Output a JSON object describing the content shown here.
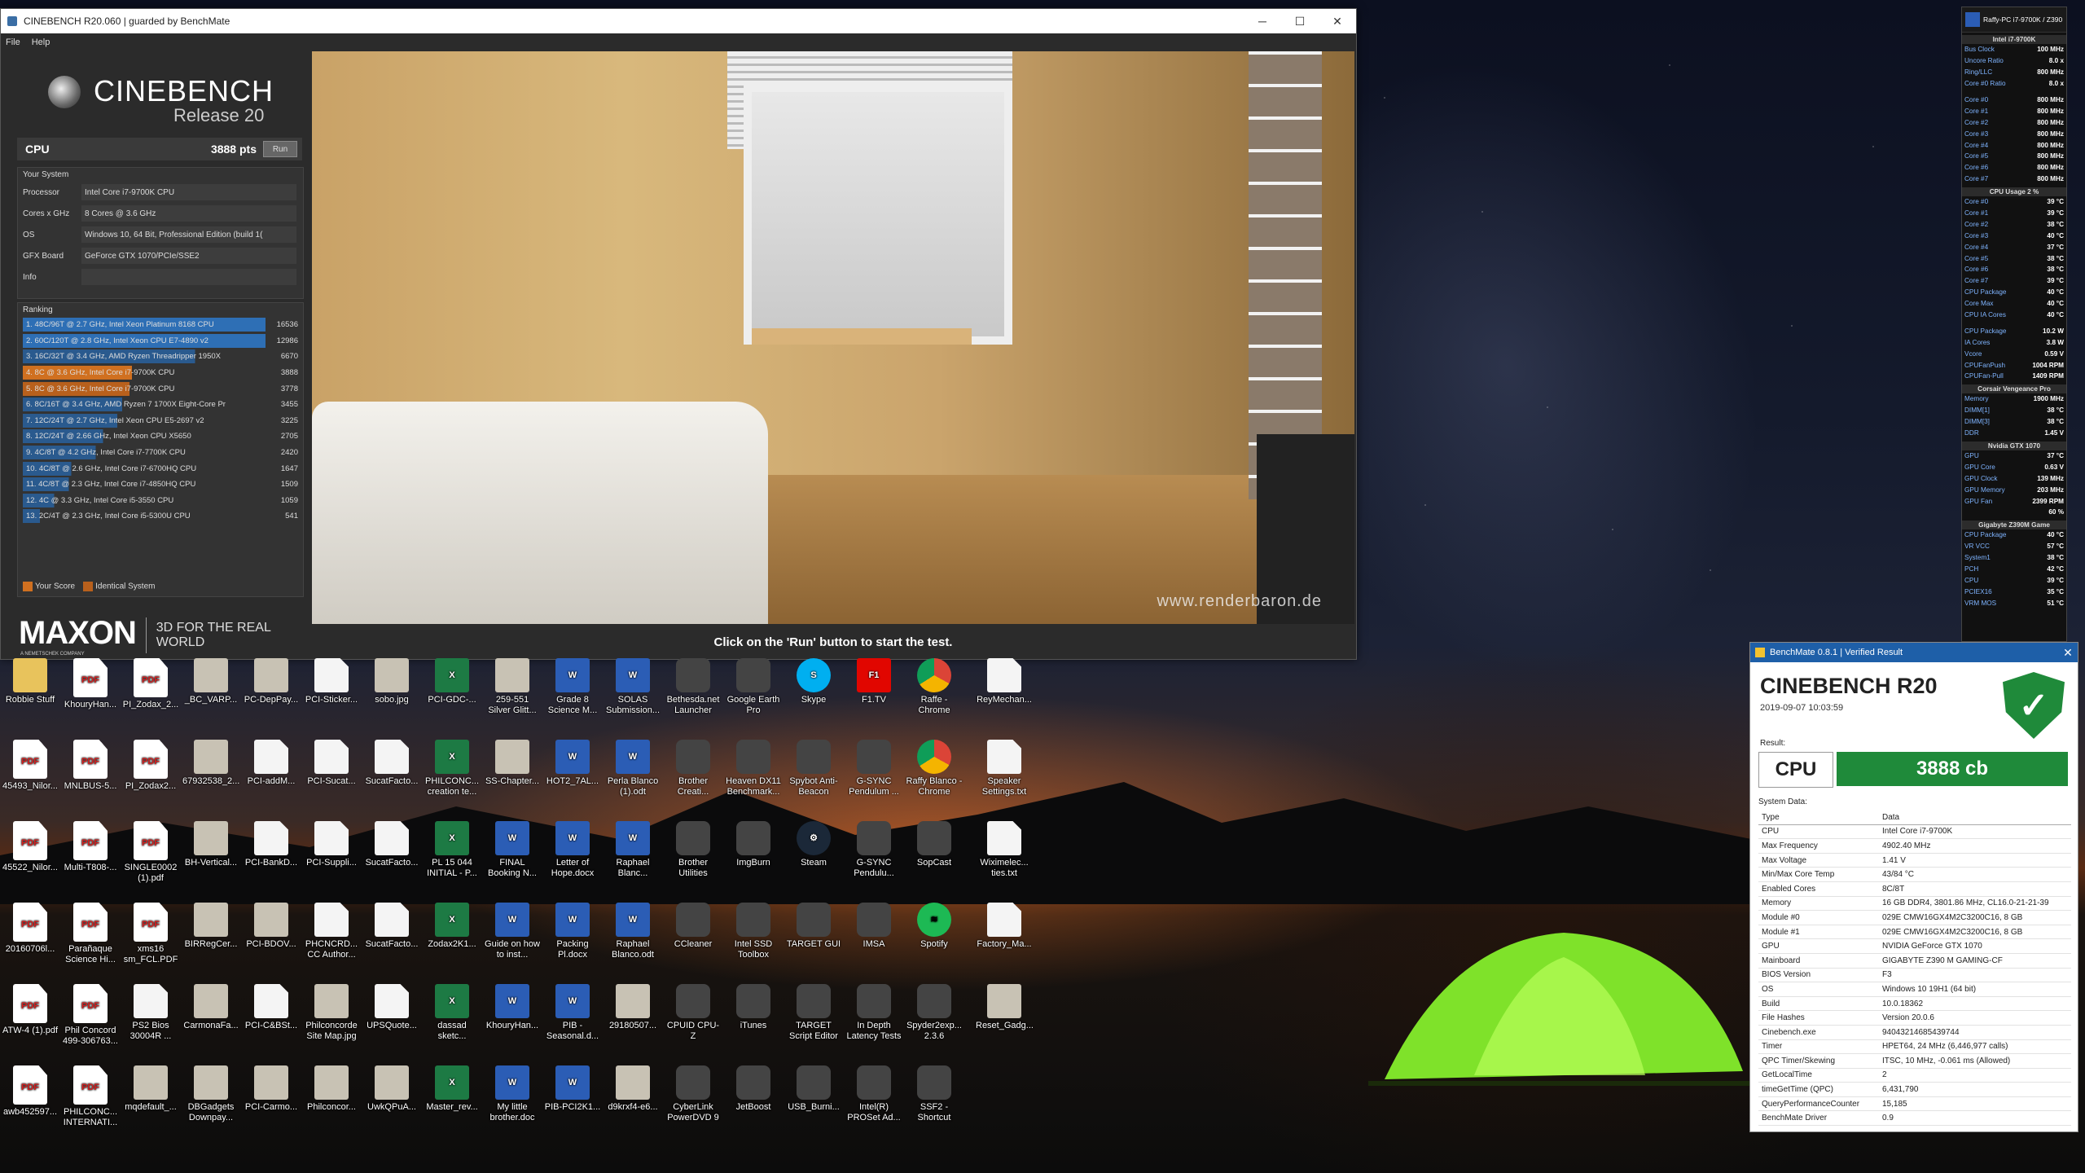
{
  "cinebench": {
    "window_title": "CINEBENCH R20.060 | guarded by BenchMate",
    "menu": [
      "File",
      "Help"
    ],
    "logo_title": "CINEBENCH",
    "logo_sub": "Release 20",
    "cpu_label": "CPU",
    "cpu_score": "3888 pts",
    "run_label": "Run",
    "your_system_title": "Your System",
    "system": [
      {
        "k": "Processor",
        "v": "Intel Core i7-9700K CPU"
      },
      {
        "k": "Cores x GHz",
        "v": "8 Cores @ 3.6 GHz"
      },
      {
        "k": "OS",
        "v": "Windows 10, 64 Bit, Professional Edition (build 1("
      },
      {
        "k": "GFX Board",
        "v": "GeForce GTX 1070/PCIe/SSE2"
      },
      {
        "k": "Info",
        "v": ""
      }
    ],
    "ranking_title": "Ranking",
    "ranking": [
      {
        "t": "1. 48C/96T @ 2.7 GHz, Intel Xeon Platinum 8168 CPU",
        "s": "16536",
        "c": "#2e6fb5"
      },
      {
        "t": "2. 60C/120T @ 2.8 GHz, Intel Xeon CPU E7-4890 v2",
        "s": "12986",
        "c": "#2e6fb5"
      },
      {
        "t": "3. 16C/32T @ 3.4 GHz, AMD Ryzen Threadripper 1950X",
        "s": "6670",
        "c": "#2a5a8e"
      },
      {
        "t": "4. 8C @ 3.6 GHz, Intel Core i7-9700K CPU",
        "s": "3888",
        "c": "#d07020"
      },
      {
        "t": "5. 8C @ 3.6 GHz, Intel Core i7-9700K CPU",
        "s": "3778",
        "c": "#b8601c"
      },
      {
        "t": "6. 8C/16T @ 3.4 GHz, AMD Ryzen 7 1700X Eight-Core Pr",
        "s": "3455",
        "c": "#2a5a8e"
      },
      {
        "t": "7. 12C/24T @ 2.7 GHz, Intel Xeon CPU E5-2697 v2",
        "s": "3225",
        "c": "#2a5a8e"
      },
      {
        "t": "8. 12C/24T @ 2.66 GHz, Intel Xeon CPU X5650",
        "s": "2705",
        "c": "#2a5a8e"
      },
      {
        "t": "9. 4C/8T @ 4.2 GHz, Intel Core i7-7700K CPU",
        "s": "2420",
        "c": "#2a5a8e"
      },
      {
        "t": "10. 4C/8T @ 2.6 GHz, Intel Core i7-6700HQ CPU",
        "s": "1647",
        "c": "#2a5a8e"
      },
      {
        "t": "11. 4C/8T @ 2.3 GHz, Intel Core i7-4850HQ CPU",
        "s": "1509",
        "c": "#2a5a8e"
      },
      {
        "t": "12. 4C @ 3.3 GHz, Intel Core i5-3550 CPU",
        "s": "1059",
        "c": "#2a5a8e"
      },
      {
        "t": "13. 2C/4T @ 2.3 GHz, Intel Core i5-5300U CPU",
        "s": "541",
        "c": "#2a5a8e"
      }
    ],
    "ranking_fill": [
      1.0,
      1.0,
      0.71,
      0.45,
      0.44,
      0.41,
      0.39,
      0.33,
      0.3,
      0.2,
      0.19,
      0.13,
      0.07
    ],
    "legend_your": "Your Score",
    "legend_identical": "Identical System",
    "maxon": "MAXON",
    "maxon_small": "A NEMETSCHEK COMPANY",
    "maxon_tag": "3D FOR THE REAL WORLD",
    "render_credit": "www.renderbaron.de",
    "status_text": "Click on the 'Run' button to start the test."
  },
  "desktop_icons": [
    [
      {
        "l": "Robbie Stuff",
        "i": "folder"
      },
      {
        "l": "KhouryHan...",
        "i": "pdf"
      },
      {
        "l": "PI_Zodax_2...",
        "i": "pdf"
      },
      {
        "l": "_BC_VARP...",
        "i": "img"
      },
      {
        "l": "PC-DepPay...",
        "i": "img"
      },
      {
        "l": "PCI-Sticker...",
        "i": "txt"
      },
      {
        "l": "sobo.jpg",
        "i": "img"
      },
      {
        "l": "PCI-GDC-...",
        "i": "xls"
      },
      {
        "l": "259-551 Silver Glitt...",
        "i": "img"
      },
      {
        "l": "Grade 8 Science M...",
        "i": "doc"
      },
      {
        "l": "SOLAS Submission...",
        "i": "doc"
      },
      {
        "l": "Bethesda.net Launcher",
        "i": "app"
      },
      {
        "l": "Google Earth Pro",
        "i": "app"
      },
      {
        "l": "Skype",
        "i": "skype"
      },
      {
        "l": "F1.TV",
        "i": "f1"
      },
      {
        "l": "Raffe - Chrome",
        "i": "chrome"
      },
      {
        "l": "ReyMechan...",
        "i": "txt"
      }
    ],
    [
      {
        "l": "45493_Nilor...",
        "i": "pdf"
      },
      {
        "l": "MNLBUS-5...",
        "i": "pdf"
      },
      {
        "l": "PI_Zodax2...",
        "i": "pdf"
      },
      {
        "l": "67932538_2...",
        "i": "img"
      },
      {
        "l": "PCI-addM...",
        "i": "txt"
      },
      {
        "l": "PCI-Sucat...",
        "i": "txt"
      },
      {
        "l": "SucatFacto...",
        "i": "txt"
      },
      {
        "l": "PHILCONC... creation te...",
        "i": "xls"
      },
      {
        "l": "SS-Chapter...",
        "i": "img"
      },
      {
        "l": "HOT2_7AL...",
        "i": "doc"
      },
      {
        "l": "Perla Blanco (1).odt",
        "i": "doc"
      },
      {
        "l": "Brother Creati...",
        "i": "app"
      },
      {
        "l": "Heaven DX11 Benchmark...",
        "i": "app"
      },
      {
        "l": "Spybot Anti-Beacon",
        "i": "app"
      },
      {
        "l": "G-SYNC Pendulum ...",
        "i": "app"
      },
      {
        "l": "Raffy Blanco - Chrome",
        "i": "chrome"
      },
      {
        "l": "Speaker Settings.txt",
        "i": "txt"
      }
    ],
    [
      {
        "l": "45522_Nilor...",
        "i": "pdf"
      },
      {
        "l": "Multi-T808-...",
        "i": "pdf"
      },
      {
        "l": "SINGLE0002 (1).pdf",
        "i": "pdf"
      },
      {
        "l": "BH-Vertical...",
        "i": "img"
      },
      {
        "l": "PCI-BankD...",
        "i": "txt"
      },
      {
        "l": "PCI-Suppli...",
        "i": "txt"
      },
      {
        "l": "SucatFacto...",
        "i": "txt"
      },
      {
        "l": "PL 15 044 INITIAL - P...",
        "i": "xls"
      },
      {
        "l": "FINAL Booking N...",
        "i": "doc"
      },
      {
        "l": "Letter of Hope.docx",
        "i": "doc"
      },
      {
        "l": "Raphael Blanc...",
        "i": "doc"
      },
      {
        "l": "Brother Utilities",
        "i": "app"
      },
      {
        "l": "ImgBurn",
        "i": "app"
      },
      {
        "l": "Steam",
        "i": "steam"
      },
      {
        "l": "G-SYNC Pendulu...",
        "i": "app"
      },
      {
        "l": "SopCast",
        "i": "app"
      },
      {
        "l": "Wiximelec... ties.txt",
        "i": "txt"
      }
    ],
    [
      {
        "l": "20160706l...",
        "i": "pdf"
      },
      {
        "l": "Parañaque Science Hi...",
        "i": "pdf"
      },
      {
        "l": "xms16 sm_FCL.PDF",
        "i": "pdf"
      },
      {
        "l": "BIRRegCer...",
        "i": "img"
      },
      {
        "l": "PCI-BDOV...",
        "i": "img"
      },
      {
        "l": "PHCNCRD... CC Author...",
        "i": "txt"
      },
      {
        "l": "SucatFacto...",
        "i": "txt"
      },
      {
        "l": "Zodax2K1...",
        "i": "xls"
      },
      {
        "l": "Guide on how to inst...",
        "i": "doc"
      },
      {
        "l": "Packing Pl.docx",
        "i": "doc"
      },
      {
        "l": "Raphael Blanco.odt",
        "i": "doc"
      },
      {
        "l": "CCleaner",
        "i": "app"
      },
      {
        "l": "Intel SSD Toolbox",
        "i": "app"
      },
      {
        "l": "TARGET GUI",
        "i": "app"
      },
      {
        "l": "IMSA",
        "i": "app"
      },
      {
        "l": "Spotify",
        "i": "spotify"
      },
      {
        "l": "Factory_Ma...",
        "i": "txt"
      }
    ],
    [
      {
        "l": "ATW-4 (1).pdf",
        "i": "pdf"
      },
      {
        "l": "Phil Concord 499-306763...",
        "i": "pdf"
      },
      {
        "l": "PS2 Bios 30004R ...",
        "i": "txt"
      },
      {
        "l": "CarmonaFa...",
        "i": "img"
      },
      {
        "l": "PCI-C&BSt...",
        "i": "txt"
      },
      {
        "l": "Philconcorde Site Map.jpg",
        "i": "img"
      },
      {
        "l": "UPSQuote...",
        "i": "txt"
      },
      {
        "l": "dassad sketc...",
        "i": "xls"
      },
      {
        "l": "KhouryHan...",
        "i": "doc"
      },
      {
        "l": "PIB - Seasonal.d...",
        "i": "doc"
      },
      {
        "l": "29180507...",
        "i": "img"
      },
      {
        "l": "CPUID CPU-Z",
        "i": "app"
      },
      {
        "l": "iTunes",
        "i": "app"
      },
      {
        "l": "TARGET Script Editor",
        "i": "app"
      },
      {
        "l": "In Depth Latency Tests",
        "i": "app"
      },
      {
        "l": "Spyder2exp... 2.3.6",
        "i": "app"
      },
      {
        "l": "Reset_Gadg...",
        "i": "img"
      }
    ],
    [
      {
        "l": "awb452597...",
        "i": "pdf"
      },
      {
        "l": "PHILCONC... INTERNATI...",
        "i": "pdf"
      },
      {
        "l": "mqdefault_...",
        "i": "img"
      },
      {
        "l": "DBGadgets Downpay...",
        "i": "img"
      },
      {
        "l": "PCI-Carmo...",
        "i": "img"
      },
      {
        "l": "Philconcor...",
        "i": "img"
      },
      {
        "l": "UwkQPuA...",
        "i": "img"
      },
      {
        "l": "Master_rev...",
        "i": "xls"
      },
      {
        "l": "My little brother.doc",
        "i": "doc"
      },
      {
        "l": "PIB-PCI2K1...",
        "i": "doc"
      },
      {
        "l": "d9krxf4-e6...",
        "i": "img"
      },
      {
        "l": "CyberLink PowerDVD 9",
        "i": "app"
      },
      {
        "l": "JetBoost",
        "i": "app"
      },
      {
        "l": "USB_Burni...",
        "i": "app"
      },
      {
        "l": "Intel(R) PROSet Ad...",
        "i": "app"
      },
      {
        "l": "SSF2 - Shortcut",
        "i": "app"
      }
    ]
  ],
  "icon_glyphs": {
    "pdf": "PDF",
    "xls": "X",
    "doc": "W",
    "txt": "",
    "img": "",
    "app": "",
    "chrome": "",
    "skype": "S",
    "steam": "⚙",
    "spotify": "≋",
    "f1": "F1",
    "folder": ""
  },
  "hwinfo": {
    "header": "Raffy-PC i7-9700K / Z390",
    "sections": [
      {
        "title": "Intel i7-9700K",
        "rows": [
          [
            "Bus Clock",
            "100 MHz"
          ],
          [
            "Uncore Ratio",
            "8.0 x"
          ],
          [
            "Ring/LLC",
            "800 MHz"
          ],
          [
            "Core #0 Ratio",
            "8.0 x"
          ]
        ]
      },
      {
        "title": "",
        "rows": [
          [
            "Core #0",
            "800 MHz"
          ],
          [
            "Core #1",
            "800 MHz"
          ],
          [
            "Core #2",
            "800 MHz"
          ],
          [
            "Core #3",
            "800 MHz"
          ],
          [
            "Core #4",
            "800 MHz"
          ],
          [
            "Core #5",
            "800 MHz"
          ],
          [
            "Core #6",
            "800 MHz"
          ],
          [
            "Core #7",
            "800 MHz"
          ]
        ]
      },
      {
        "title": "CPU Usage  2 %",
        "rows": [
          [
            "Core #0",
            "39 °C"
          ],
          [
            "Core #1",
            "39 °C"
          ],
          [
            "Core #2",
            "38 °C"
          ],
          [
            "Core #3",
            "40 °C"
          ],
          [
            "Core #4",
            "37 °C"
          ],
          [
            "Core #5",
            "38 °C"
          ],
          [
            "Core #6",
            "38 °C"
          ],
          [
            "Core #7",
            "39 °C"
          ],
          [
            "CPU Package",
            "40 °C"
          ],
          [
            "Core Max",
            "40 °C"
          ],
          [
            "CPU IA Cores",
            "40 °C"
          ]
        ]
      },
      {
        "title": "",
        "rows": [
          [
            "CPU Package",
            "10.2 W"
          ],
          [
            "IA Cores",
            "3.8 W"
          ],
          [
            "Vcore",
            "0.59 V"
          ],
          [
            "CPUFanPush",
            "1004 RPM"
          ],
          [
            "CPUFan-Pull",
            "1409 RPM"
          ]
        ]
      },
      {
        "title": "Corsair Vengeance Pro",
        "rows": [
          [
            "Memory",
            "1900 MHz"
          ],
          [
            "DIMM[1]",
            "38 °C"
          ],
          [
            "DIMM[3]",
            "38 °C"
          ],
          [
            "DDR",
            "1.45 V"
          ]
        ]
      },
      {
        "title": "Nvidia GTX 1070",
        "rows": [
          [
            "GPU",
            "37 °C"
          ],
          [
            "GPU Core",
            "0.63 V"
          ],
          [
            "GPU Clock",
            "139 MHz"
          ],
          [
            "GPU Memory",
            "203 MHz"
          ],
          [
            "GPU Fan",
            "2399 RPM"
          ],
          [
            "",
            "60 %"
          ]
        ]
      },
      {
        "title": "Gigabyte Z390M Game",
        "rows": [
          [
            "CPU Package",
            "40 °C"
          ],
          [
            "VR VCC",
            "57 °C"
          ],
          [
            "System1",
            "38 °C"
          ],
          [
            "PCH",
            "42 °C"
          ],
          [
            "CPU",
            "39 °C"
          ],
          [
            "PCIEX16",
            "35 °C"
          ],
          [
            "VRM MOS",
            "51 °C"
          ]
        ]
      }
    ]
  },
  "benchmate": {
    "title": "BenchMate 0.8.1 | Verified Result",
    "heading": "CINEBENCH R20",
    "date": "2019-09-07 10:03:59",
    "result_label": "Result:",
    "cpu_label": "CPU",
    "score": "3888 cb",
    "system_label": "System Data:",
    "rows": [
      [
        "Type",
        "Data"
      ],
      [
        "CPU",
        "Intel Core i7-9700K"
      ],
      [
        "Max Frequency",
        "4902.40 MHz"
      ],
      [
        "Max Voltage",
        "1.41 V"
      ],
      [
        "Min/Max Core Temp",
        "43/84 °C"
      ],
      [
        "Enabled Cores",
        "8C/8T"
      ],
      [
        "Memory",
        "16 GB DDR4, 3801.86 MHz, CL16.0-21-21-39"
      ],
      [
        "Module #0",
        "029E CMW16GX4M2C3200C16, 8 GB"
      ],
      [
        "Module #1",
        "029E CMW16GX4M2C3200C16, 8 GB"
      ],
      [
        "GPU",
        "NVIDIA GeForce GTX 1070"
      ],
      [
        "Mainboard",
        "GIGABYTE Z390 M GAMING-CF"
      ],
      [
        "BIOS Version",
        "F3"
      ],
      [
        "OS",
        "Windows 10 19H1 (64 bit)"
      ],
      [
        "Build",
        "10.0.18362"
      ],
      [
        "File Hashes",
        "Version 20.0.6"
      ],
      [
        "Cinebench.exe",
        "94043214685439744"
      ],
      [
        "Timer",
        "HPET64, 24 MHz (6,446,977 calls)"
      ],
      [
        "QPC Timer/Skewing",
        "ITSC, 10 MHz, -0.061 ms (Allowed)"
      ],
      [
        "GetLocalTime",
        "2"
      ],
      [
        "timeGetTime (QPC)",
        "6,431,790"
      ],
      [
        "QueryPerformanceCounter",
        "15,185"
      ],
      [
        "BenchMate Driver",
        "0.9"
      ]
    ]
  }
}
